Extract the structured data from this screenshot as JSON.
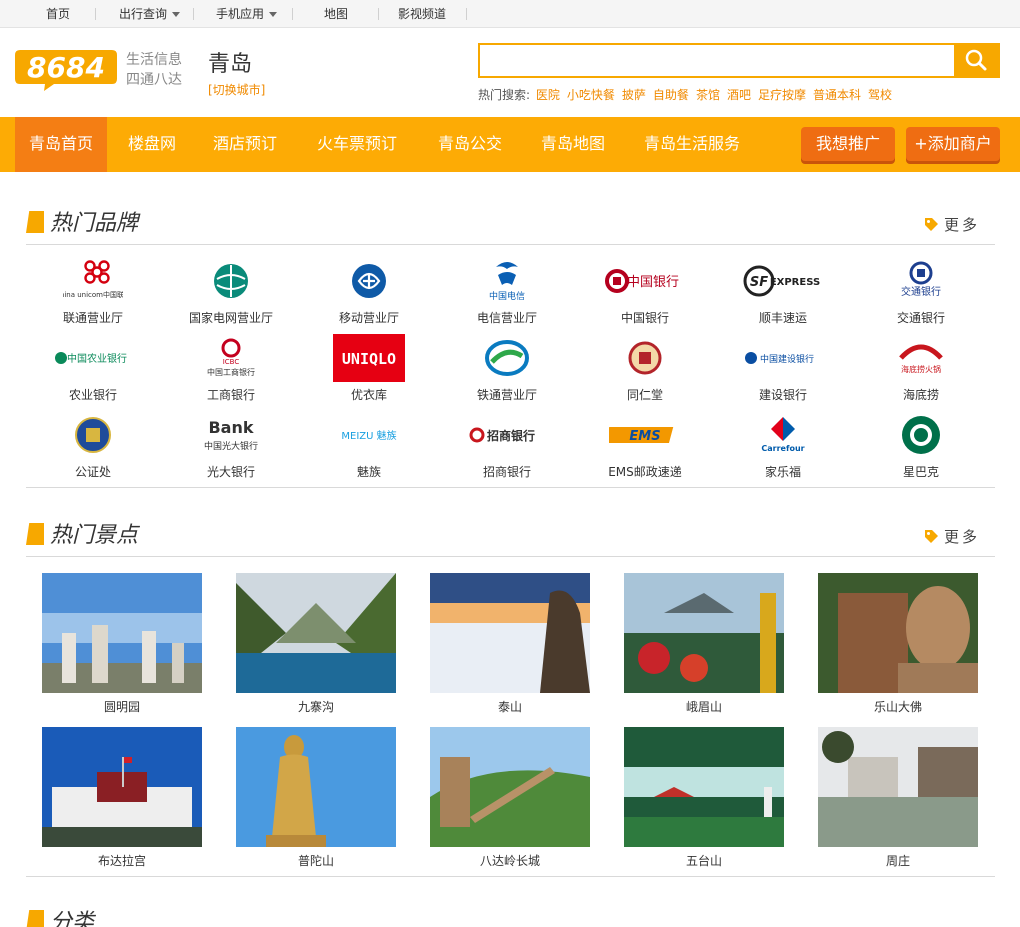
{
  "topbar": {
    "items": [
      {
        "label": "首页"
      },
      {
        "label": "出行查询",
        "has_menu": true
      },
      {
        "label": "手机应用",
        "has_menu": true
      },
      {
        "label": "地图"
      },
      {
        "label": "影视频道"
      }
    ]
  },
  "header": {
    "logo_text": "8684",
    "slogan_line1": "生活信息",
    "slogan_line2": "四通八达",
    "city": "青岛",
    "switch_city": "[切换城市]",
    "search": {
      "value": "",
      "placeholder": ""
    },
    "hot_label": "热门搜索:",
    "hot_terms": [
      "医院",
      "小吃快餐",
      "披萨",
      "自助餐",
      "茶馆",
      "酒吧",
      "足疗按摩",
      "普通本科",
      "驾校"
    ]
  },
  "nav": {
    "items": [
      "青岛首页",
      "楼盘网",
      "酒店预订",
      "火车票预订",
      "青岛公交",
      "青岛地图",
      "青岛生活服务"
    ],
    "active_index": 0,
    "promote_label": "我想推广",
    "add_merchant_label": "+添加商户"
  },
  "brands_section": {
    "title": "热门品牌",
    "more_label": "更多",
    "items": [
      {
        "name": "联通营业厅",
        "logo_text": "China unicom中国联通"
      },
      {
        "name": "国家电网营业厅",
        "logo_text": ""
      },
      {
        "name": "移动营业厅",
        "logo_text": ""
      },
      {
        "name": "电信营业厅",
        "logo_text": "中国电信"
      },
      {
        "name": "中国银行",
        "logo_text": "中国银行"
      },
      {
        "name": "顺丰速运",
        "logo_text": "EXPRESS"
      },
      {
        "name": "交通银行",
        "logo_text": "交通银行"
      },
      {
        "name": "农业银行",
        "logo_text": "中国农业银行"
      },
      {
        "name": "工商银行",
        "logo_text": "中国工商银行"
      },
      {
        "name": "优衣库",
        "logo_text": "UNIQLO"
      },
      {
        "name": "铁通营业厅",
        "logo_text": ""
      },
      {
        "name": "同仁堂",
        "logo_text": ""
      },
      {
        "name": "建设银行",
        "logo_text": "中国建设银行"
      },
      {
        "name": "海底捞",
        "logo_text": "海底捞火锅"
      },
      {
        "name": "公证处",
        "logo_text": ""
      },
      {
        "name": "光大银行",
        "logo_text": "中国光大银行"
      },
      {
        "name": "魅族",
        "logo_text": "MEIZU 魅族"
      },
      {
        "name": "招商银行",
        "logo_text": "招商银行"
      },
      {
        "name": "EMS邮政速递",
        "logo_text": "EMS"
      },
      {
        "name": "家乐福",
        "logo_text": "Carrefour"
      },
      {
        "name": "星巴克",
        "logo_text": ""
      }
    ]
  },
  "spots_section": {
    "title": "热门景点",
    "more_label": "更多",
    "items": [
      {
        "name": "圆明园"
      },
      {
        "name": "九寨沟"
      },
      {
        "name": "泰山"
      },
      {
        "name": "峨眉山"
      },
      {
        "name": "乐山大佛"
      },
      {
        "name": "布达拉宫"
      },
      {
        "name": "普陀山"
      },
      {
        "name": "八达岭长城"
      },
      {
        "name": "五台山"
      },
      {
        "name": "周庄"
      }
    ]
  },
  "category_section": {
    "title": "分类"
  },
  "colors": {
    "accent": "#fdab05",
    "nav_active": "#f47e14",
    "button": "#ef6d12",
    "link": "#f08a00"
  }
}
